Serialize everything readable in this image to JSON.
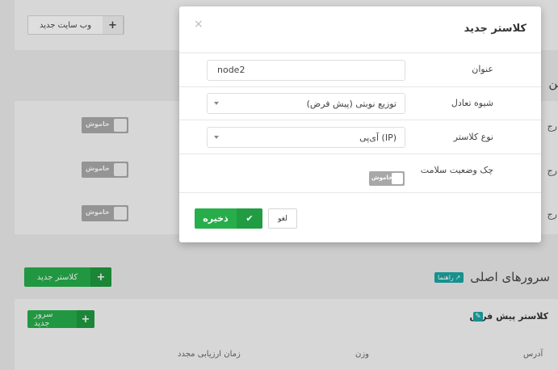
{
  "background": {
    "new_website_button": "وب سایت جدید",
    "section1_title_partial": "تن",
    "rows": [
      {
        "label": "ارج",
        "toggle": "خاموش"
      },
      {
        "label": "ارج",
        "toggle": "خاموش"
      },
      {
        "label": "ارج",
        "toggle": "خاموش"
      }
    ],
    "new_cluster_button": "کلاستر جدید",
    "main_servers_title": "سرورهای اصلی",
    "guide_badge": "راهنما",
    "default_cluster_title": "کلاستر پیش فرض",
    "new_server_button": "سرور جدید",
    "columns": [
      "آدرس",
      "وزن",
      "زمان ارزیابی مجدد"
    ]
  },
  "modal": {
    "title": "کلاستر جدید",
    "close_icon": "×",
    "fields": {
      "title_label": "عنوان",
      "title_value": "node2",
      "balance_label": "شیوه تعادل",
      "balance_value": "توزیع نوبتی (پیش فرض)",
      "type_label": "نوع کلاستر",
      "type_value": "آی‌پی (IP)",
      "health_label": "چک وضعیت سلامت",
      "health_toggle": "خاموش"
    },
    "save_label": "ذخیره",
    "cancel_label": "لغو"
  }
}
